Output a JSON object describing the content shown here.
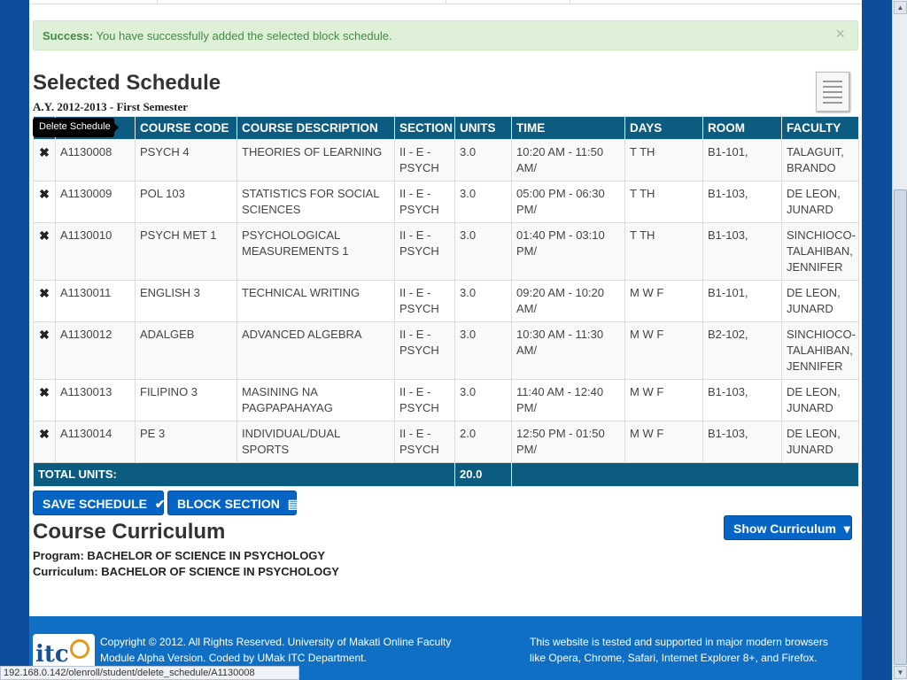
{
  "alert": {
    "strong": "Success:",
    "message": "You have successfully added the selected block schedule.",
    "close": "×"
  },
  "schedule": {
    "title": "Selected Schedule",
    "academic_year": "A.Y. 2012-2013 - First Semester",
    "tooltip": "Delete Schedule",
    "delete_glyph": "✖",
    "headers": [
      "",
      "",
      "COURSE CODE",
      "COURSE DESCRIPTION",
      "SECTION",
      "UNITS",
      "TIME",
      "DAYS",
      "ROOM",
      "FACULTY"
    ],
    "rows": [
      {
        "id": "A1130008",
        "code": "PSYCH 4",
        "desc": "THEORIES OF LEARNING",
        "section": "II - E - PSYCH",
        "units": "3.0",
        "time": "10:20 AM - 11:50 AM/",
        "days": "T TH",
        "room": "B1-101,",
        "faculty": "TALAGUIT, BRANDO"
      },
      {
        "id": "A1130009",
        "code": "POL 103",
        "desc": "STATISTICS FOR SOCIAL SCIENCES",
        "section": "II - E - PSYCH",
        "units": "3.0",
        "time": "05:00 PM - 06:30 PM/",
        "days": "T TH",
        "room": "B1-103,",
        "faculty": "DE LEON, JUNARD"
      },
      {
        "id": "A1130010",
        "code": "PSYCH MET 1",
        "desc": "PSYCHOLOGICAL MEASUREMENTS 1",
        "section": "II - E - PSYCH",
        "units": "3.0",
        "time": "01:40 PM - 03:10 PM/",
        "days": "T TH",
        "room": "B1-103,",
        "faculty": "SINCHIOCO-TALAHIBAN, JENNIFER"
      },
      {
        "id": "A1130011",
        "code": "ENGLISH 3",
        "desc": "TECHNICAL WRITING",
        "section": "II - E - PSYCH",
        "units": "3.0",
        "time": "09:20 AM - 10:20 AM/",
        "days": "M W F",
        "room": "B1-101,",
        "faculty": "DE LEON, JUNARD"
      },
      {
        "id": "A1130012",
        "code": "ADALGEB",
        "desc": "ADVANCED ALGEBRA",
        "section": "II - E - PSYCH",
        "units": "3.0",
        "time": "10:30 AM - 11:30 AM/",
        "days": "M W F",
        "room": "B2-102,",
        "faculty": "SINCHIOCO-TALAHIBAN, JENNIFER"
      },
      {
        "id": "A1130013",
        "code": "FILIPINO 3",
        "desc": "MASINING NA PAGPAPAHAYAG",
        "section": "II - E - PSYCH",
        "units": "3.0",
        "time": "11:40 AM - 12:40 PM/",
        "days": "M W F",
        "room": "B1-103,",
        "faculty": "DE LEON, JUNARD"
      },
      {
        "id": "A1130014",
        "code": "PE 3",
        "desc": "INDIVIDUAL/DUAL SPORTS",
        "section": "II - E - PSYCH",
        "units": "2.0",
        "time": "12:50 PM - 01:50 PM/",
        "days": "M W F",
        "room": "B1-103,",
        "faculty": "DE LEON, JUNARD"
      }
    ],
    "total_label": "TOTAL UNITS:",
    "total_value": "20.0"
  },
  "buttons": {
    "save": "SAVE SCHEDULE",
    "save_icon": "✔",
    "block": "BLOCK SECTION",
    "block_icon": "▤",
    "show_curriculum": "Show Curriculum",
    "show_curriculum_icon": "▾"
  },
  "curriculum": {
    "title": "Course Curriculum",
    "program": "Program: BACHELOR OF SCIENCE IN PSYCHOLOGY",
    "curriculum": "Curriculum: BACHELOR OF SCIENCE IN PSYCHOLOGY"
  },
  "footer": {
    "logo_text": "itc",
    "left_line1": "Copyright © 2012. All Rights Reserved. University of Makati Online Faculty",
    "left_line2": "Module Alpha Version. Coded by UMak ITC Department.",
    "right_line1": "This website is tested and supported in major modern browsers",
    "right_line2": "like Opera, Chrome, Safari, Internet Explorer 8+, and Firefox."
  },
  "statusbar": {
    "url": "192.168.0.142/olenroll/student/delete_schedule/A1130008"
  },
  "colors": {
    "page_bg": "#0d4e9c",
    "table_header": "#0c5c82",
    "button": "#0664c4",
    "alert_bg": "#dff0d8",
    "footer": "#0f6fc4"
  }
}
